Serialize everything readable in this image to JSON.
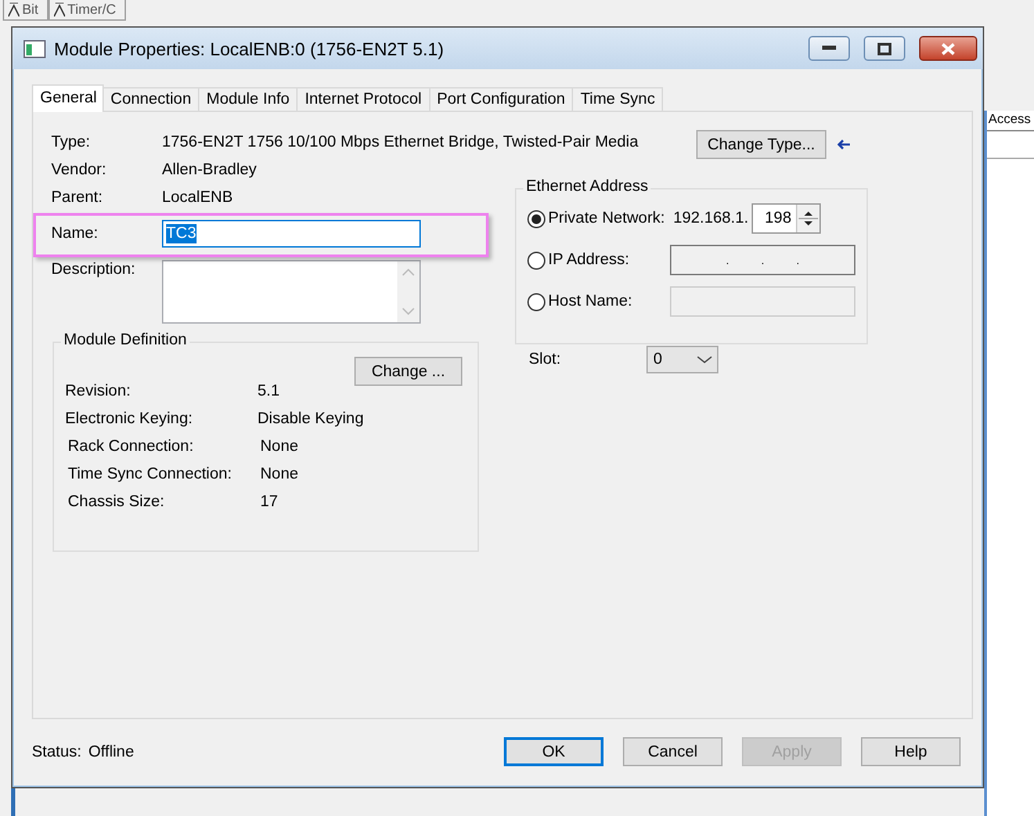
{
  "background_app": {
    "toolbar_items": [
      "Bit",
      "Timer/C"
    ],
    "column_header": "Access"
  },
  "window": {
    "title": "Module Properties: LocalENB:0 (1756-EN2T 5.1)"
  },
  "tabs": [
    {
      "label": "General",
      "selected": true
    },
    {
      "label": "Connection",
      "selected": false
    },
    {
      "label": "Module Info",
      "selected": false
    },
    {
      "label": "Internet Protocol",
      "selected": false
    },
    {
      "label": "Port Configuration",
      "selected": false
    },
    {
      "label": "Time Sync",
      "selected": false
    }
  ],
  "general": {
    "fields": [
      {
        "label": "Type:",
        "value": "1756-EN2T 1756 10/100 Mbps Ethernet Bridge, Twisted-Pair Media"
      },
      {
        "label": "Vendor:",
        "value": "Allen-Bradley"
      },
      {
        "label": "Parent:",
        "value": "LocalENB"
      }
    ],
    "change_type_button": "Change Type...",
    "name": {
      "label": "Name:",
      "value": "TC3",
      "highlighted": true
    },
    "description": {
      "label": "Description:"
    },
    "module_definition": {
      "title": "Module Definition",
      "change_button": "Change ...",
      "rows": [
        {
          "label": "Revision:",
          "value": "5.1"
        },
        {
          "label": "Electronic Keying:",
          "value": "Disable Keying"
        },
        {
          "label": "Rack Connection:",
          "value": "None"
        },
        {
          "label": "Time Sync Connection:",
          "value": "None"
        },
        {
          "label": "Chassis Size:",
          "value": "17"
        }
      ]
    },
    "ethernet_address": {
      "title": "Ethernet Address",
      "options": [
        {
          "kind": "private",
          "label": "Private Network:",
          "selected": true,
          "prefix": "192.168.1.",
          "value": "198"
        },
        {
          "kind": "ip",
          "label": "IP Address:",
          "selected": false,
          "separators": [
            ".",
            ".",
            "."
          ]
        },
        {
          "kind": "host",
          "label": "Host Name:",
          "selected": false
        }
      ]
    },
    "slot": {
      "label": "Slot:",
      "value": "0"
    }
  },
  "status": {
    "label": "Status:",
    "value": "Offline"
  },
  "buttons": [
    {
      "label": "OK",
      "default": true,
      "disabled": false
    },
    {
      "label": "Cancel",
      "default": false,
      "disabled": false
    },
    {
      "label": "Apply",
      "default": false,
      "disabled": true
    },
    {
      "label": "Help",
      "default": false,
      "disabled": false
    }
  ]
}
